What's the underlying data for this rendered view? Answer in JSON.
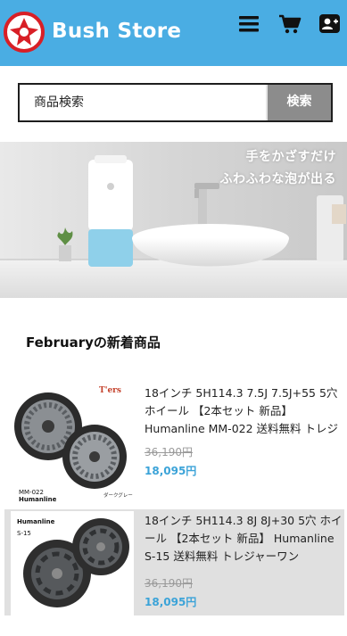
{
  "header": {
    "brand": "Bush Store",
    "logo_colors": {
      "ring": "#d81f26",
      "background": "#ffffff"
    },
    "background_color": "#4aade3",
    "icons": [
      "hamburger-menu-icon",
      "shopping-cart-icon",
      "user-add-icon"
    ]
  },
  "search": {
    "placeholder": "商品検索",
    "button_label": "検索"
  },
  "banner": {
    "line1": "手をかざすだけ",
    "line2": "ふわふわな泡が出る"
  },
  "section": {
    "title": "Februaryの新着商品"
  },
  "products": [
    {
      "name": "18インチ 5H114.3 7.5J 7.5J+55 5穴 ホイール 【2本セット 新品】 Humanline MM-022 送料無料 トレジャーワン",
      "old_price": "36,190円",
      "price": "18,095円",
      "thumb_brand": "Humanline",
      "thumb_model": "MM-022",
      "thumb_badge": "T'ers",
      "thumb_color_label": "ダークグレー"
    },
    {
      "name": "18インチ 5H114.3 8J 8J+30 5穴 ホイール 【2本セット 新品】 Humanline S-15 送料無料 トレジャーワン",
      "old_price": "36,190円",
      "price": "18,095円",
      "thumb_brand": "Humanline",
      "thumb_model": "S-15"
    }
  ],
  "colors": {
    "accent": "#4aade3",
    "price": "#3ba3d8",
    "old_price": "#9a9a9a",
    "search_button": "#8c8c8c"
  }
}
